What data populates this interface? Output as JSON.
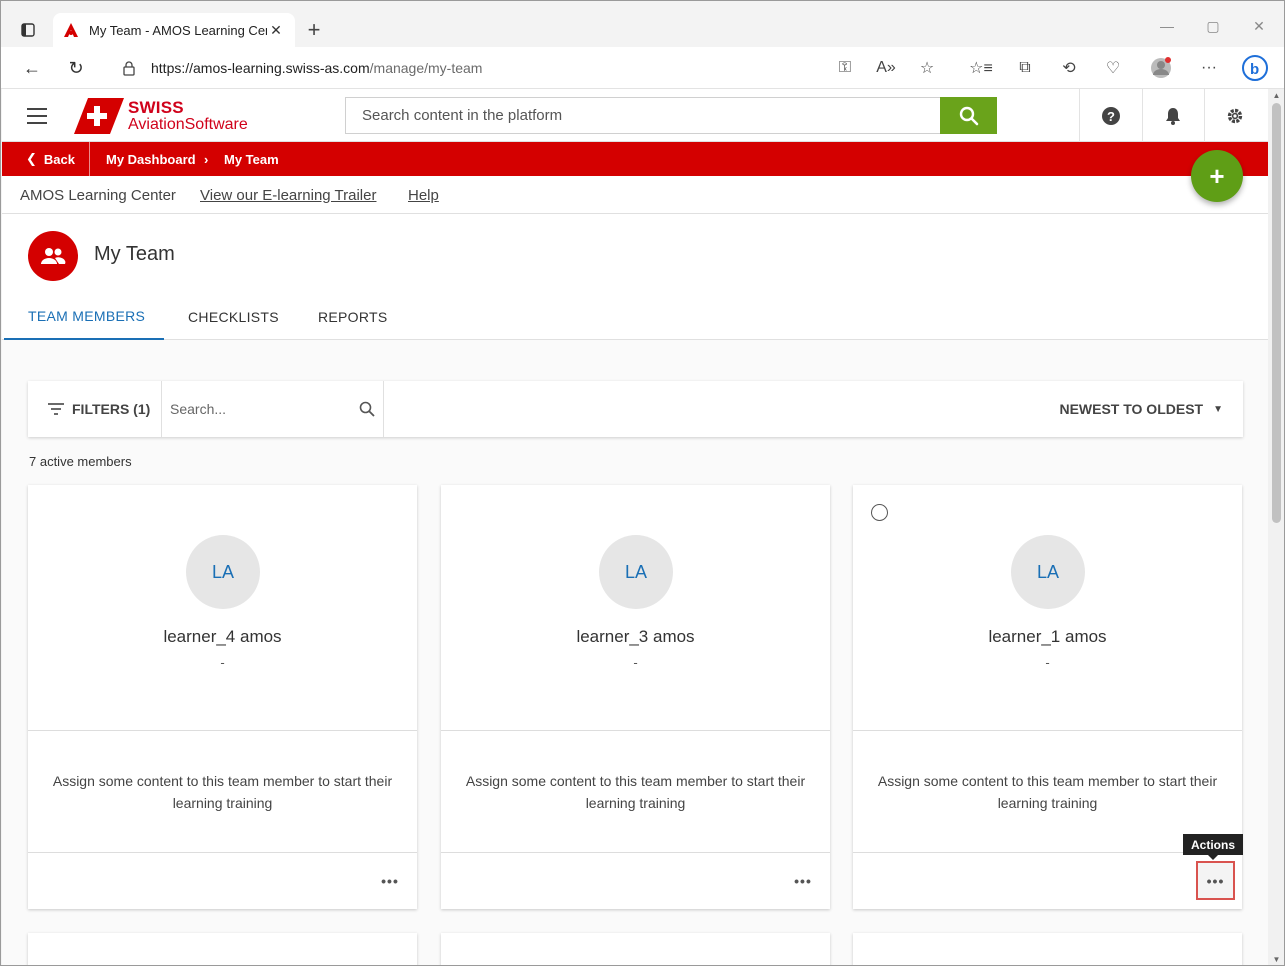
{
  "browser": {
    "tab_title": "My Team - AMOS Learning Cent",
    "url_host": "https://amos-learning.swiss-as.com",
    "url_path": "/manage/my-team"
  },
  "header": {
    "logo_line1": "SWISS",
    "logo_line2": "AviationSoftware",
    "search_placeholder": "Search content in the platform"
  },
  "breadcrumb": {
    "back": "Back",
    "items": [
      "My Dashboard",
      "My Team"
    ],
    "separator": "›"
  },
  "subnav": {
    "items": [
      "AMOS Learning Center",
      "View our E-learning Trailer",
      "Help"
    ]
  },
  "page": {
    "title": "My Team",
    "tabs": [
      "TEAM MEMBERS",
      "CHECKLISTS",
      "REPORTS"
    ],
    "active_tab": "TEAM MEMBERS"
  },
  "toolbar": {
    "filters_label": "FILTERS (1)",
    "search_placeholder": "Search...",
    "sort_label": "NEWEST TO OLDEST"
  },
  "member_count": "7 active members",
  "members": [
    {
      "initials": "LA",
      "name": "learner_4 amos",
      "sub": "-",
      "message": "Assign some content to this team member to start their learning training"
    },
    {
      "initials": "LA",
      "name": "learner_3 amos",
      "sub": "-",
      "message": "Assign some content to this team member to start their learning training"
    },
    {
      "initials": "LA",
      "name": "learner_1 amos",
      "sub": "-",
      "message": "Assign some content to this team member to start their learning training"
    }
  ],
  "tooltip": "Actions",
  "more_label": "•••",
  "fab_label": "+",
  "colors": {
    "brand_red": "#d40000",
    "search_green": "#6aa31b",
    "fab_green": "#5f9e16",
    "accent_blue": "#1a6fb5"
  }
}
